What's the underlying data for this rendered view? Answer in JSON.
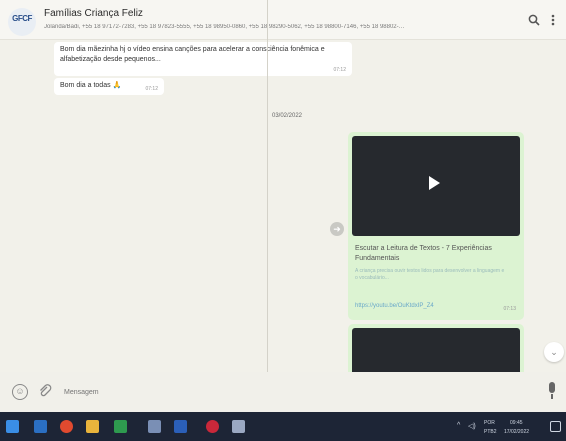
{
  "header": {
    "avatar_text": "GFCF",
    "group_name": "Famílias Criança Feliz",
    "participants": "Jolanda/Badi, +55 18 97172-7283, +55 18 97823-5555, +55 18 98950-0860, +55 18 98290-5062, +55 18 98800-7146, +55 18 98802-…",
    "search_icon": "search-icon",
    "menu_icon": "vertical-dots-icon"
  },
  "messages": [
    {
      "text": "Bom dia mãezinha hj o vídeo ensina canções para acelerar a consciência fonêmica e alfabetização desde pequenos...",
      "time": "07:12"
    },
    {
      "text": "Bom dia a todas 🙏",
      "time": "07:12"
    }
  ],
  "date_chip": "03/02/2022",
  "shared_link": {
    "title": "Escutar a Leitura de Textos - 7 Experiências Fundamentais",
    "description": "A criança precisa ouvir textos lidos para desenvolver a linguagem e o vocabulário...",
    "url": "https://youtu.be/OuKtdxIP_Z4",
    "time": "07:13"
  },
  "composer": {
    "placeholder": "Mensagem"
  },
  "taskbar": {
    "lang": "POR",
    "layout": "PTB2",
    "time": "09:45",
    "date": "17/02/2022"
  },
  "colors": {
    "accent": "#dcf3d2",
    "header_bg": "#f7f6f2",
    "taskbar_bg": "#1d2536"
  }
}
